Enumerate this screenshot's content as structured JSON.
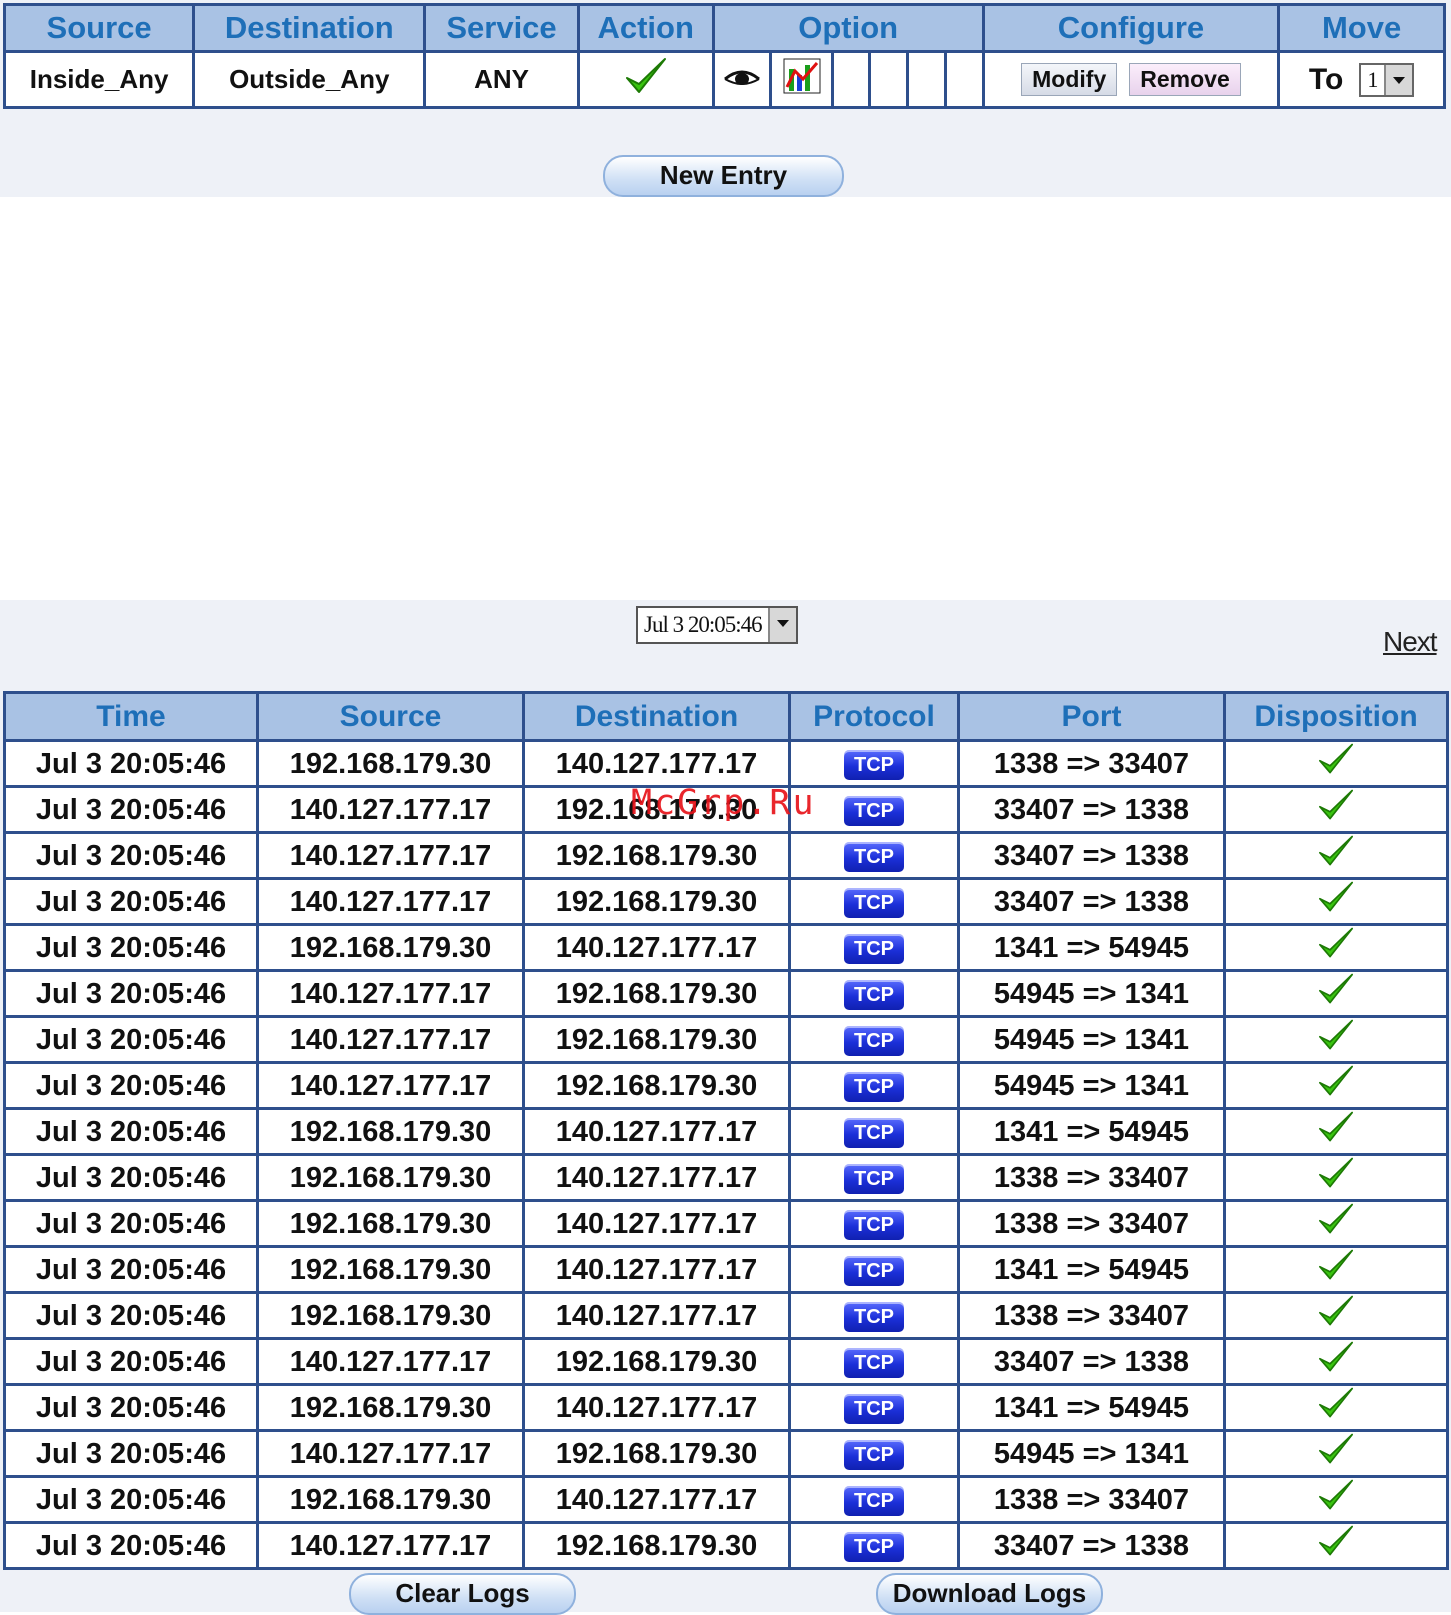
{
  "policy": {
    "headers": [
      "Source",
      "Destination",
      "Service",
      "Action",
      "Option",
      "Configure",
      "Move"
    ],
    "row": {
      "source": "Inside_Any",
      "destination": "Outside_Any",
      "service": "ANY",
      "action_icon": "check-icon",
      "option_icons": [
        "eye-icon",
        "chart-icon"
      ],
      "modify_label": "Modify",
      "remove_label": "Remove",
      "move_to_label": "To",
      "move_to_value": "1"
    },
    "new_entry_label": "New Entry"
  },
  "log": {
    "time_select_value": "Jul 3 20:05:46",
    "next_label": "Next",
    "headers": [
      "Time",
      "Source",
      "Destination",
      "Protocol",
      "Port",
      "Disposition"
    ],
    "rows": [
      {
        "time": "Jul 3 20:05:46",
        "source": "192.168.179.30",
        "destination": "140.127.177.17",
        "protocol": "TCP",
        "port": "1338 => 33407"
      },
      {
        "time": "Jul 3 20:05:46",
        "source": "140.127.177.17",
        "destination": "192.168.179.30",
        "protocol": "TCP",
        "port": "33407 => 1338"
      },
      {
        "time": "Jul 3 20:05:46",
        "source": "140.127.177.17",
        "destination": "192.168.179.30",
        "protocol": "TCP",
        "port": "33407 => 1338"
      },
      {
        "time": "Jul 3 20:05:46",
        "source": "140.127.177.17",
        "destination": "192.168.179.30",
        "protocol": "TCP",
        "port": "33407 => 1338"
      },
      {
        "time": "Jul 3 20:05:46",
        "source": "192.168.179.30",
        "destination": "140.127.177.17",
        "protocol": "TCP",
        "port": "1341 => 54945"
      },
      {
        "time": "Jul 3 20:05:46",
        "source": "140.127.177.17",
        "destination": "192.168.179.30",
        "protocol": "TCP",
        "port": "54945 => 1341"
      },
      {
        "time": "Jul 3 20:05:46",
        "source": "140.127.177.17",
        "destination": "192.168.179.30",
        "protocol": "TCP",
        "port": "54945 => 1341"
      },
      {
        "time": "Jul 3 20:05:46",
        "source": "140.127.177.17",
        "destination": "192.168.179.30",
        "protocol": "TCP",
        "port": "54945 => 1341"
      },
      {
        "time": "Jul 3 20:05:46",
        "source": "192.168.179.30",
        "destination": "140.127.177.17",
        "protocol": "TCP",
        "port": "1341 => 54945"
      },
      {
        "time": "Jul 3 20:05:46",
        "source": "192.168.179.30",
        "destination": "140.127.177.17",
        "protocol": "TCP",
        "port": "1338 => 33407"
      },
      {
        "time": "Jul 3 20:05:46",
        "source": "192.168.179.30",
        "destination": "140.127.177.17",
        "protocol": "TCP",
        "port": "1338 => 33407"
      },
      {
        "time": "Jul 3 20:05:46",
        "source": "192.168.179.30",
        "destination": "140.127.177.17",
        "protocol": "TCP",
        "port": "1341 => 54945"
      },
      {
        "time": "Jul 3 20:05:46",
        "source": "192.168.179.30",
        "destination": "140.127.177.17",
        "protocol": "TCP",
        "port": "1338 => 33407"
      },
      {
        "time": "Jul 3 20:05:46",
        "source": "140.127.177.17",
        "destination": "192.168.179.30",
        "protocol": "TCP",
        "port": "33407 => 1338"
      },
      {
        "time": "Jul 3 20:05:46",
        "source": "192.168.179.30",
        "destination": "140.127.177.17",
        "protocol": "TCP",
        "port": "1341 => 54945"
      },
      {
        "time": "Jul 3 20:05:46",
        "source": "140.127.177.17",
        "destination": "192.168.179.30",
        "protocol": "TCP",
        "port": "54945 => 1341"
      },
      {
        "time": "Jul 3 20:05:46",
        "source": "192.168.179.30",
        "destination": "140.127.177.17",
        "protocol": "TCP",
        "port": "1338 => 33407"
      },
      {
        "time": "Jul 3 20:05:46",
        "source": "140.127.177.17",
        "destination": "192.168.179.30",
        "protocol": "TCP",
        "port": "33407 => 1338"
      }
    ],
    "disposition_icon": "check-icon",
    "clear_logs_label": "Clear Logs",
    "download_logs_label": "Download Logs"
  },
  "watermark": "McGrp.Ru",
  "colors": {
    "header_bg": "#a9c2e4",
    "header_text": "#1e6fb8",
    "border": "#2e4f8c",
    "panel_bg": "#eef1f7",
    "tcp_badge": "#1b2fd8",
    "check": "#39c40f"
  }
}
